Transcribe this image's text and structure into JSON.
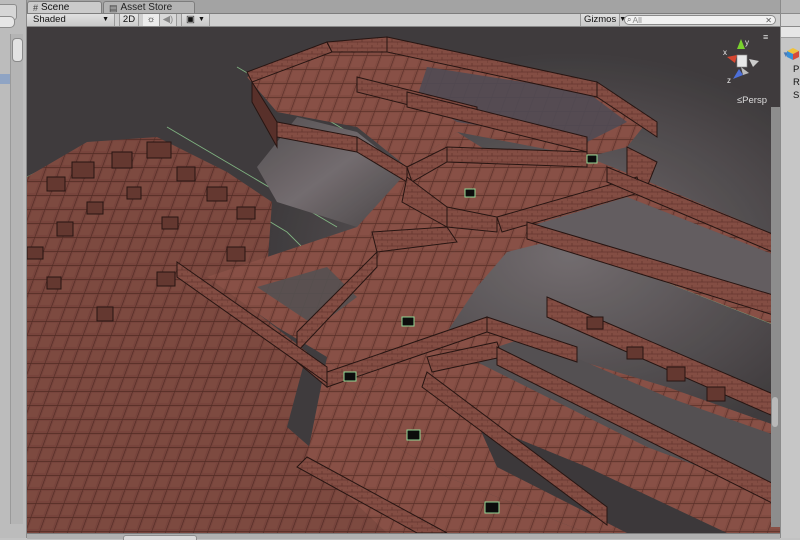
{
  "tabs": [
    {
      "label": "Scene",
      "icon": "scene-grid-icon",
      "active": true
    },
    {
      "label": "Asset Store",
      "icon": "asset-store-icon",
      "active": false
    }
  ],
  "toolbar": {
    "shading_mode": "Shaded",
    "btn_2d": "2D",
    "gizmos": "Gizmos",
    "search_placeholder": "All"
  },
  "viewport": {
    "projection_label": "Persp",
    "axes": {
      "x": "x",
      "y": "y",
      "z": "z"
    }
  },
  "inspector": {
    "row_labels": [
      "P",
      "R",
      "S"
    ]
  },
  "colors": {
    "brick": "#8c5147",
    "wall_shade": "#3f2521",
    "grid_line": "#9ee6a0",
    "axis_x": "#d6452f",
    "axis_y": "#7ad12e",
    "axis_z": "#4d6fd8"
  }
}
